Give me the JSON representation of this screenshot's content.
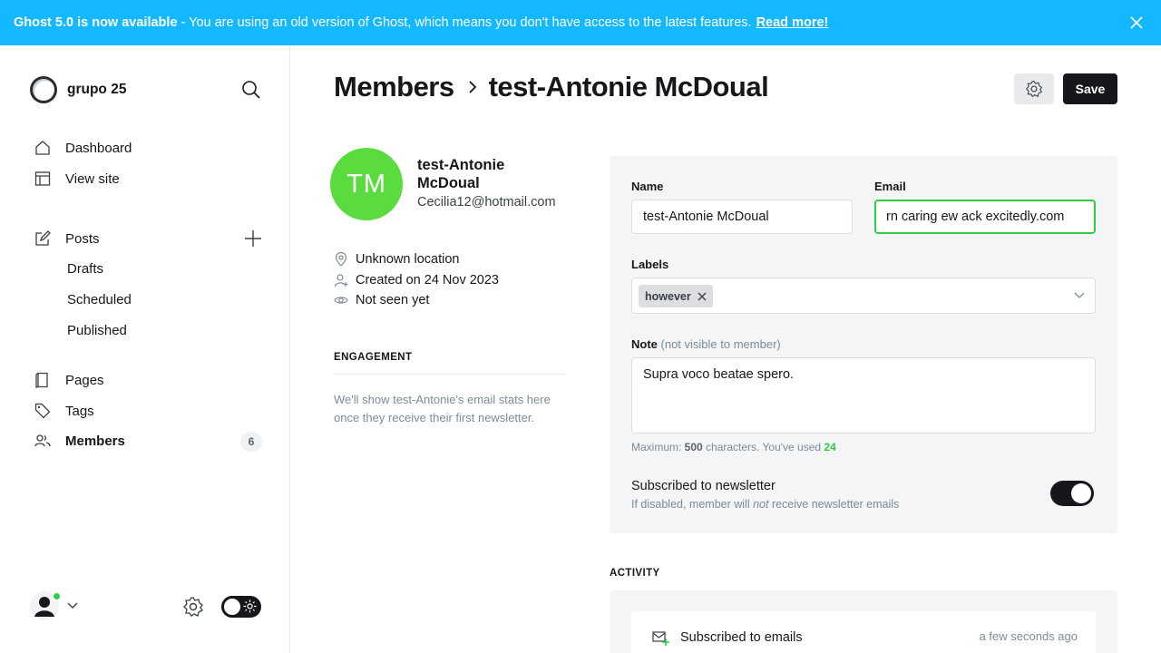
{
  "banner": {
    "bold": "Ghost 5.0 is now available",
    "text": " - You are using an old version of Ghost, which means you don't have access to the latest features.",
    "link": "Read more!",
    "color": "#14b8ff"
  },
  "sidebar": {
    "site_name": "grupo 25",
    "nav": {
      "dashboard": "Dashboard",
      "view_site": "View site",
      "posts": "Posts",
      "drafts": "Drafts",
      "scheduled": "Scheduled",
      "published": "Published",
      "pages": "Pages",
      "tags": "Tags",
      "members": "Members"
    },
    "members_count": "6"
  },
  "header": {
    "breadcrumb_parent": "Members",
    "breadcrumb_current": "test-Antonie McDoual",
    "save_label": "Save"
  },
  "member": {
    "initials": "TM",
    "name": "test-Antonie McDoual",
    "email": "Cecilia12@hotmail.com",
    "avatar_color": "#5bdc3e",
    "location": "Unknown location",
    "created": "Created on 24 Nov 2023",
    "last_seen": "Not seen yet"
  },
  "engagement": {
    "title": "ENGAGEMENT",
    "text": "We'll show test-Antonie's email stats here once they receive their first newsletter."
  },
  "form": {
    "name_label": "Name",
    "name_value": "test-Antonie McDoual",
    "email_label": "Email",
    "email_value": "rn caring ew ack excitedly.com",
    "labels_label": "Labels",
    "label_chip": "however",
    "note_label": "Note",
    "note_hint": "(not visible to member)",
    "note_value": "Supra voco beatae spero.",
    "counter_prefix": "Maximum: ",
    "counter_max": "500",
    "counter_mid": " characters. You've used ",
    "counter_used": "24",
    "newsletter_title": "Subscribed to newsletter",
    "newsletter_desc_1": "If disabled, member will ",
    "newsletter_desc_em": "not",
    "newsletter_desc_2": " receive newsletter emails",
    "newsletter_enabled": true
  },
  "activity": {
    "title": "ACTIVITY",
    "items": [
      {
        "text": "Subscribed to emails",
        "time": "a few seconds ago"
      }
    ]
  }
}
